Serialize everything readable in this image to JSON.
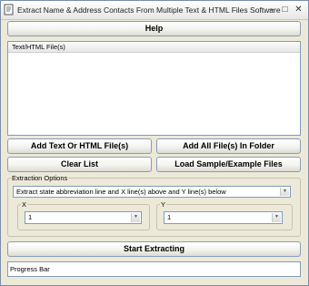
{
  "window": {
    "title": "Extract Name & Address Contacts From Multiple Text & HTML Files Software"
  },
  "help_button": "Help",
  "file_list": {
    "header": "Text/HTML File(s)",
    "items": []
  },
  "buttons": {
    "add_files": "Add Text Or HTML File(s)",
    "add_folder": "Add All File(s) In Folder",
    "clear_list": "Clear List",
    "load_sample": "Load Sample/Example Files",
    "start": "Start Extracting"
  },
  "extraction_options": {
    "legend": "Extraction Options",
    "mode_value": "Extract state abbreviation line and X line(s) above and Y line(s) below",
    "x_label": "X",
    "x_value": "1",
    "y_label": "Y",
    "y_value": "1"
  },
  "progress_bar": {
    "label": "Progress Bar",
    "progress": 0
  },
  "icons": {
    "app": "app-icon",
    "minimize": "minimize-icon",
    "maximize": "maximize-icon",
    "close": "close-icon"
  }
}
